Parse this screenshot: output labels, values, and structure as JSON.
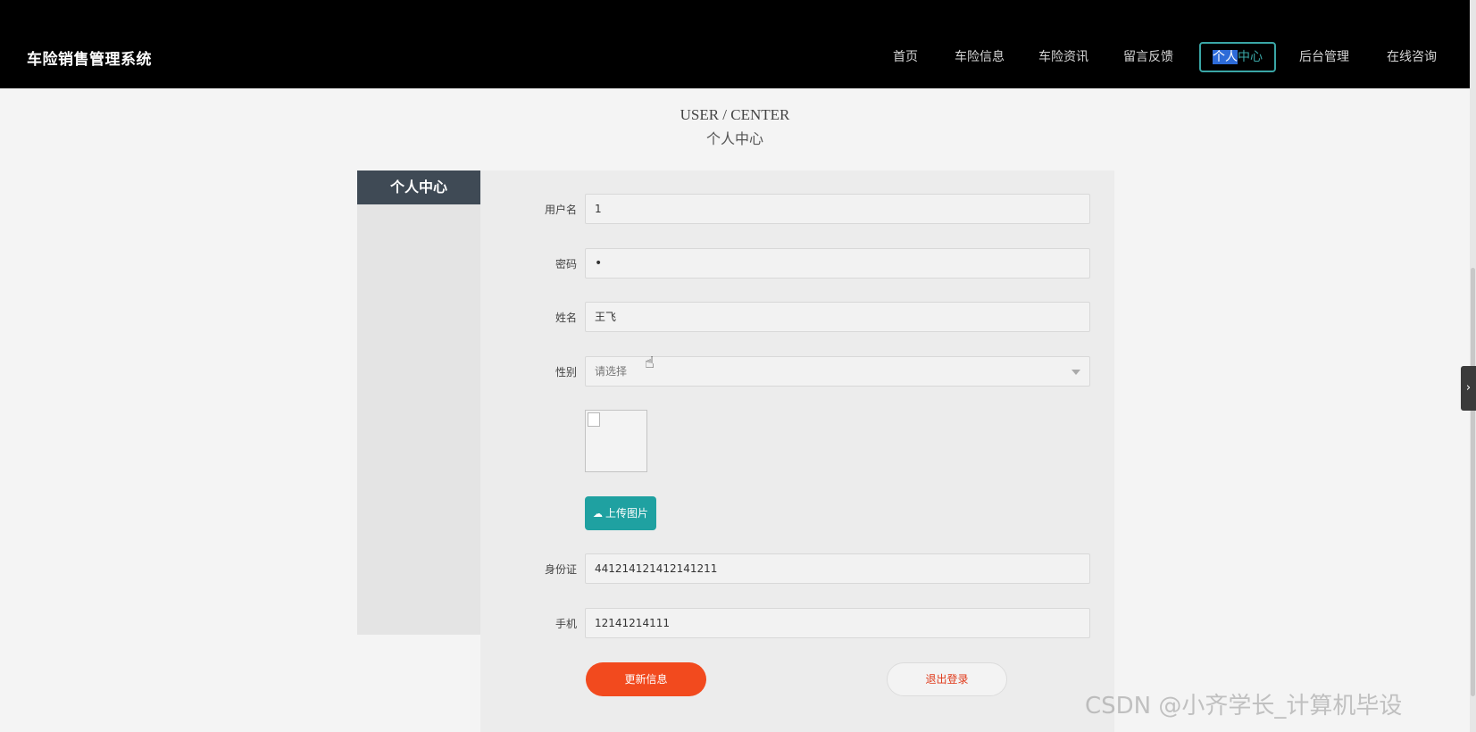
{
  "app": {
    "title": "车险销售管理系统"
  },
  "nav": {
    "items": [
      {
        "label": "首页"
      },
      {
        "label": "车险信息"
      },
      {
        "label": "车险资讯"
      },
      {
        "label": "留言反馈"
      },
      {
        "label_hl": "个人",
        "label_rest": "中心"
      },
      {
        "label": "后台管理"
      },
      {
        "label": "在线咨询"
      }
    ],
    "accent_color": "#3aa6a6"
  },
  "page": {
    "title_en": "USER / CENTER",
    "title_cn": "个人中心"
  },
  "side_menu": {
    "header": "个人中心"
  },
  "form": {
    "username": {
      "label": "用户名",
      "value": "1"
    },
    "password": {
      "label": "密码",
      "value": "•"
    },
    "name": {
      "label": "姓名",
      "value": "王飞"
    },
    "gender": {
      "label": "性别",
      "placeholder": "请选择"
    },
    "upload_label": "上传图片",
    "id_card": {
      "label": "身份证",
      "value": "441214121412141211"
    },
    "phone": {
      "label": "手机",
      "value": "12141214111"
    },
    "update_label": "更新信息",
    "logout_label": "退出登录"
  },
  "colors": {
    "update_button": "#f24a1e",
    "upload_button": "#1fa1a1",
    "menu_header": "#3f4a55"
  },
  "icons": {
    "upload": "cloud-upload-icon",
    "toggle": "chevron-right-icon",
    "cursor": "hand-pointer-icon"
  },
  "watermark": "CSDN @小齐学长_计算机毕设"
}
